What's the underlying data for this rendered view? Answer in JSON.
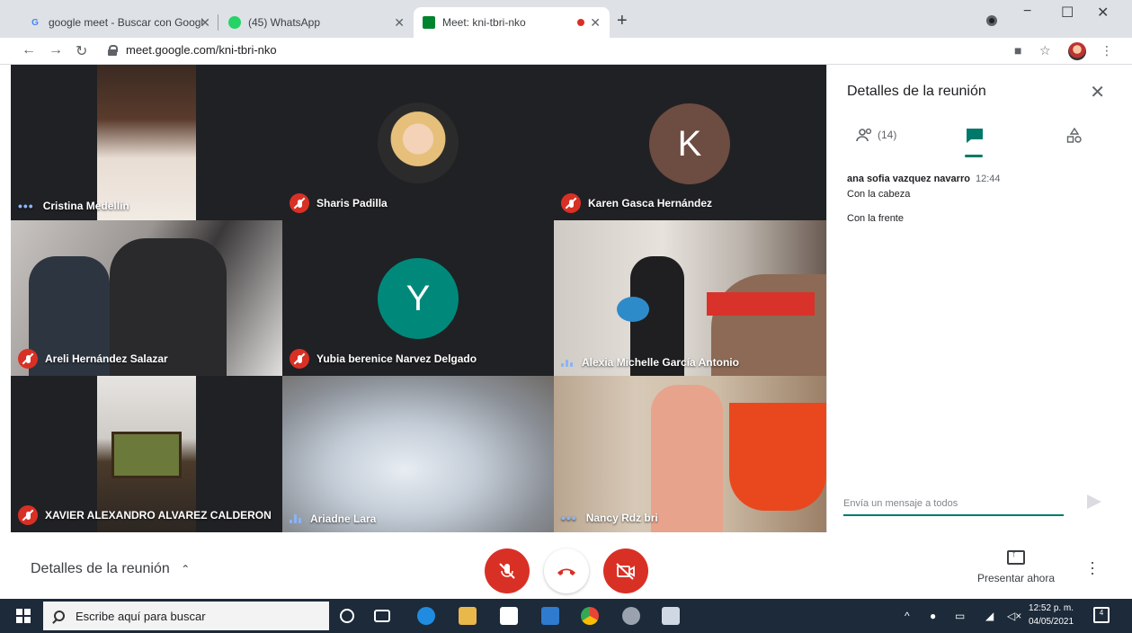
{
  "browser": {
    "tabs": [
      {
        "title": "google meet - Buscar con Googl",
        "favicon": "google-icon"
      },
      {
        "title": "(45) WhatsApp",
        "favicon": "whatsapp-icon"
      },
      {
        "title": "Meet: kni-tbri-nko",
        "favicon": "meet-icon"
      }
    ],
    "url": "meet.google.com/kni-tbri-nko",
    "new_tab": "+",
    "win_min": "−",
    "win_max": "☐",
    "win_close": "✕"
  },
  "meet": {
    "participants": [
      {
        "name": "Cristina Medellín",
        "mic": "active"
      },
      {
        "name": "Sharis Padilla",
        "mic": "muted"
      },
      {
        "name": "Karen Gasca Hernández",
        "mic": "muted",
        "avatar_letter": "K",
        "avatar_color": "#6d4c41"
      },
      {
        "name": "Areli Hernández Salazar",
        "mic": "muted"
      },
      {
        "name": "Yubia berenice Narvez Delgado",
        "mic": "muted",
        "avatar_letter": "Y",
        "avatar_color": "#00897b"
      },
      {
        "name": "Alexia Michelle García Antonio",
        "mic": "speaking"
      },
      {
        "name": "XAVIER ALEXANDRO ALVAREZ CALDERON",
        "mic": "muted"
      },
      {
        "name": "Ariadne Lara",
        "mic": "speaking"
      },
      {
        "name": "Nancy Rdz bri",
        "mic": "active"
      }
    ]
  },
  "panel": {
    "title": "Detalles de la reunión",
    "people_count": "(14)",
    "messages": [
      {
        "sender": "ana sofia vazquez navarro",
        "time": "12:44",
        "text": "Con la cabeza"
      },
      {
        "sender": "",
        "time": "",
        "text": "Con la frente"
      }
    ],
    "chat_placeholder": "Envía un mensaje a todos"
  },
  "controls": {
    "meeting_details": "Detalles de la reunión",
    "present_now": "Presentar ahora"
  },
  "taskbar": {
    "search_placeholder": "Escribe aquí para buscar",
    "time": "12:52 p. m.",
    "date": "04/05/2021",
    "notification_count": "4"
  },
  "colors": {
    "meet_red": "#d93025",
    "meet_teal": "#00796b",
    "stage_bg": "#202124"
  }
}
